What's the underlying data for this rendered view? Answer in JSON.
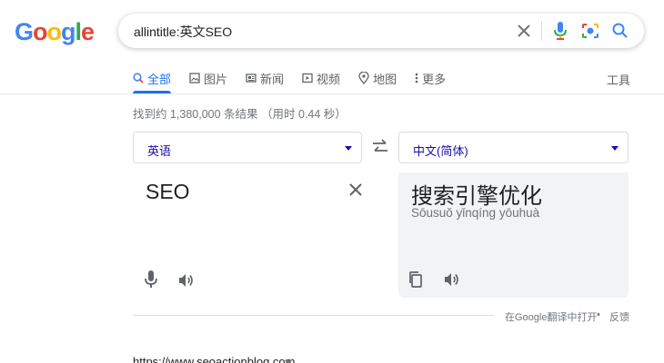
{
  "logo": {
    "g1": "G",
    "o1": "o",
    "o2": "o",
    "g2": "g",
    "l": "l",
    "e": "e"
  },
  "search": {
    "query": "allintitle:英文SEO"
  },
  "tabs": [
    {
      "label": "全部",
      "icon": "search-icon"
    },
    {
      "label": "图片",
      "icon": "image-icon"
    },
    {
      "label": "新闻",
      "icon": "news-icon"
    },
    {
      "label": "视频",
      "icon": "video-icon"
    },
    {
      "label": "地图",
      "icon": "map-pin-icon"
    },
    {
      "label": "更多",
      "icon": "more-vert-icon"
    }
  ],
  "tools_label": "工具",
  "result_stats": "找到约 1,380,000 条结果 （用时 0.44 秒）",
  "translate": {
    "source_lang": "英语",
    "target_lang": "中文(简体)",
    "source_text": "SEO",
    "target_text": "搜索引擎优化",
    "target_pinyin": "Sōusuǒ yǐnqíng yōuhuà",
    "open_in_label": "在Google翻译中打开",
    "separator": "•",
    "feedback_label": "反馈"
  },
  "result": {
    "url": "https://www.seoactionblog.com"
  },
  "colors": {
    "accent": "#1a73e8",
    "link": "#1a0dab",
    "muted": "#70757a",
    "panel": "#f1f3f4"
  }
}
